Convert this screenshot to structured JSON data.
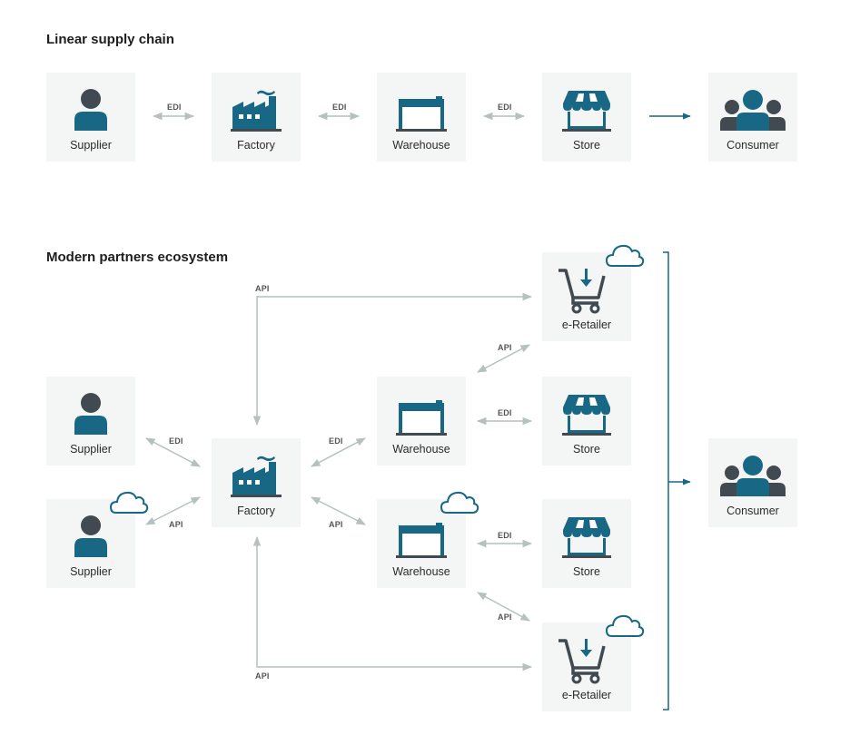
{
  "sections": {
    "linear": {
      "title": "Linear supply chain"
    },
    "modern": {
      "title": "Modern partners ecosystem"
    }
  },
  "colors": {
    "primary": "#176785",
    "dark": "#414a50",
    "connector": "#b5c0bf",
    "node_bg": "#f4f5f5"
  },
  "linear": {
    "nodes": [
      {
        "label": "Supplier",
        "icon": "person-icon"
      },
      {
        "label": "Factory",
        "icon": "factory-icon"
      },
      {
        "label": "Warehouse",
        "icon": "warehouse-icon"
      },
      {
        "label": "Store",
        "icon": "store-icon"
      },
      {
        "label": "Consumer",
        "icon": "group-icon"
      }
    ],
    "edges": [
      {
        "from": "Supplier",
        "to": "Factory",
        "label": "EDI",
        "type": "bidirectional"
      },
      {
        "from": "Factory",
        "to": "Warehouse",
        "label": "EDI",
        "type": "bidirectional"
      },
      {
        "from": "Warehouse",
        "to": "Store",
        "label": "EDI",
        "type": "bidirectional"
      },
      {
        "from": "Store",
        "to": "Consumer",
        "label": "",
        "type": "directed"
      }
    ]
  },
  "modern": {
    "nodes": [
      {
        "id": "eretailer1",
        "label": "e-Retailer",
        "icon": "cart-icon",
        "cloud": true
      },
      {
        "id": "supplier1",
        "label": "Supplier",
        "icon": "person-icon",
        "cloud": false
      },
      {
        "id": "warehouse1",
        "label": "Warehouse",
        "icon": "warehouse-icon",
        "cloud": false
      },
      {
        "id": "store1",
        "label": "Store",
        "icon": "store-icon",
        "cloud": false
      },
      {
        "id": "factory",
        "label": "Factory",
        "icon": "factory-icon",
        "cloud": false
      },
      {
        "id": "consumer",
        "label": "Consumer",
        "icon": "group-icon",
        "cloud": false
      },
      {
        "id": "supplier2",
        "label": "Supplier",
        "icon": "person-icon",
        "cloud": true
      },
      {
        "id": "warehouse2",
        "label": "Warehouse",
        "icon": "warehouse-icon",
        "cloud": true
      },
      {
        "id": "store2",
        "label": "Store",
        "icon": "store-icon",
        "cloud": false
      },
      {
        "id": "eretailer2",
        "label": "e-Retailer",
        "icon": "cart-icon",
        "cloud": true
      }
    ],
    "edges": [
      {
        "from": "factory",
        "to": "eretailer1",
        "label": "API"
      },
      {
        "from": "warehouse1",
        "to": "eretailer1",
        "label": "API"
      },
      {
        "from": "supplier1",
        "to": "factory",
        "label": "EDI"
      },
      {
        "from": "factory",
        "to": "warehouse1",
        "label": "EDI"
      },
      {
        "from": "warehouse1",
        "to": "store1",
        "label": "EDI"
      },
      {
        "from": "supplier2",
        "to": "factory",
        "label": "API"
      },
      {
        "from": "factory",
        "to": "warehouse2",
        "label": "API"
      },
      {
        "from": "warehouse2",
        "to": "store2",
        "label": "EDI"
      },
      {
        "from": "warehouse2",
        "to": "eretailer2",
        "label": "API"
      },
      {
        "from": "factory",
        "to": "eretailer2",
        "label": "API"
      },
      {
        "from": "retail-channels",
        "to": "consumer",
        "label": ""
      }
    ]
  }
}
